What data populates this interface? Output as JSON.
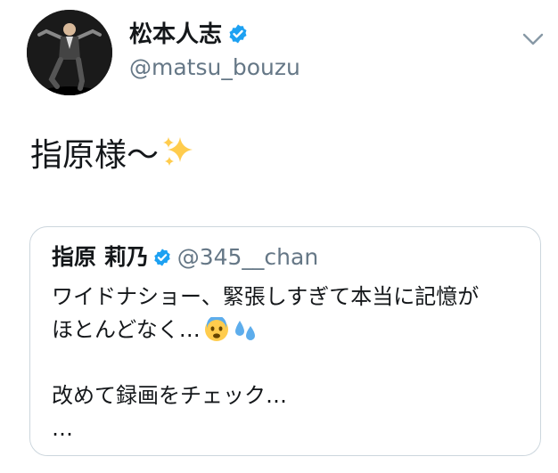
{
  "author": {
    "display_name": "松本人志",
    "handle": "@matsu_bouzu",
    "verified": true,
    "avatar_icon": "person-pose-avatar"
  },
  "menu": {
    "icon": "chevron-down-icon"
  },
  "tweet": {
    "text": "指原様〜",
    "emoji": "sparkles-icon"
  },
  "quote": {
    "display_name": "指原 莉乃",
    "handle": "@345__chan",
    "verified": true,
    "line1": "ワイドナショー、緊張しすぎて本当に記憶が",
    "line2": "ほとんどなく…",
    "line2_emojis": [
      "fearful-face-icon",
      "sweat-droplets-icon"
    ],
    "line3": "",
    "line4": "改めて録画をチェック…",
    "line5": "…"
  },
  "colors": {
    "text": "#14171a",
    "secondary": "#657786",
    "verified_blue": "#1da1f2",
    "border": "#ccd6dd",
    "sparkle": "#ffcc4d"
  }
}
